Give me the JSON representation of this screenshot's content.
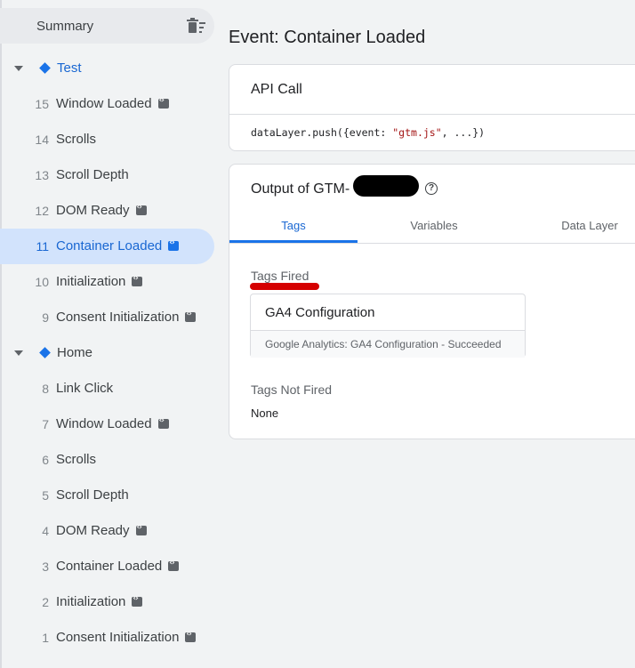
{
  "sidebar": {
    "summary_label": "Summary",
    "groups": [
      {
        "label": "Test",
        "items": [
          {
            "num": "15",
            "name": "Window Loaded",
            "badge": true
          },
          {
            "num": "14",
            "name": "Scrolls",
            "badge": false
          },
          {
            "num": "13",
            "name": "Scroll Depth",
            "badge": false
          },
          {
            "num": "12",
            "name": "DOM Ready",
            "badge": true
          },
          {
            "num": "11",
            "name": "Container Loaded",
            "badge": true,
            "active": true
          },
          {
            "num": "10",
            "name": "Initialization",
            "badge": true
          },
          {
            "num": "9",
            "name": "Consent Initialization",
            "badge": true
          }
        ]
      },
      {
        "label": "Home",
        "items": [
          {
            "num": "8",
            "name": "Link Click",
            "badge": false
          },
          {
            "num": "7",
            "name": "Window Loaded",
            "badge": true
          },
          {
            "num": "6",
            "name": "Scrolls",
            "badge": false
          },
          {
            "num": "5",
            "name": "Scroll Depth",
            "badge": false
          },
          {
            "num": "4",
            "name": "DOM Ready",
            "badge": true
          },
          {
            "num": "3",
            "name": "Container Loaded",
            "badge": true
          },
          {
            "num": "2",
            "name": "Initialization",
            "badge": true
          },
          {
            "num": "1",
            "name": "Consent Initialization",
            "badge": true
          }
        ]
      }
    ]
  },
  "main": {
    "title": "Event: Container Loaded",
    "api_call": {
      "heading": "API Call",
      "code_prefix": "dataLayer.push({event: ",
      "code_string": "\"gtm.js\"",
      "code_suffix": ", ...})"
    },
    "output": {
      "title": "Output of GTM-",
      "help_glyph": "?",
      "tabs": [
        "Tags",
        "Variables",
        "Data Layer"
      ],
      "active_tab": "Tags",
      "tags_fired_label": "Tags Fired",
      "fired_tags": [
        {
          "name": "GA4 Configuration",
          "status": "Google Analytics: GA4 Configuration - Succeeded"
        }
      ],
      "tags_not_fired_label": "Tags Not Fired",
      "not_fired_value": "None"
    }
  },
  "colors": {
    "accent": "#1a73e8",
    "active_bg": "#d2e3fc",
    "annotation_red": "#d50000"
  },
  "icons": {
    "summary": "delete-sweep-icon",
    "group": "diamond-icon",
    "badge": "code-icon",
    "help": "help-circle-icon"
  }
}
